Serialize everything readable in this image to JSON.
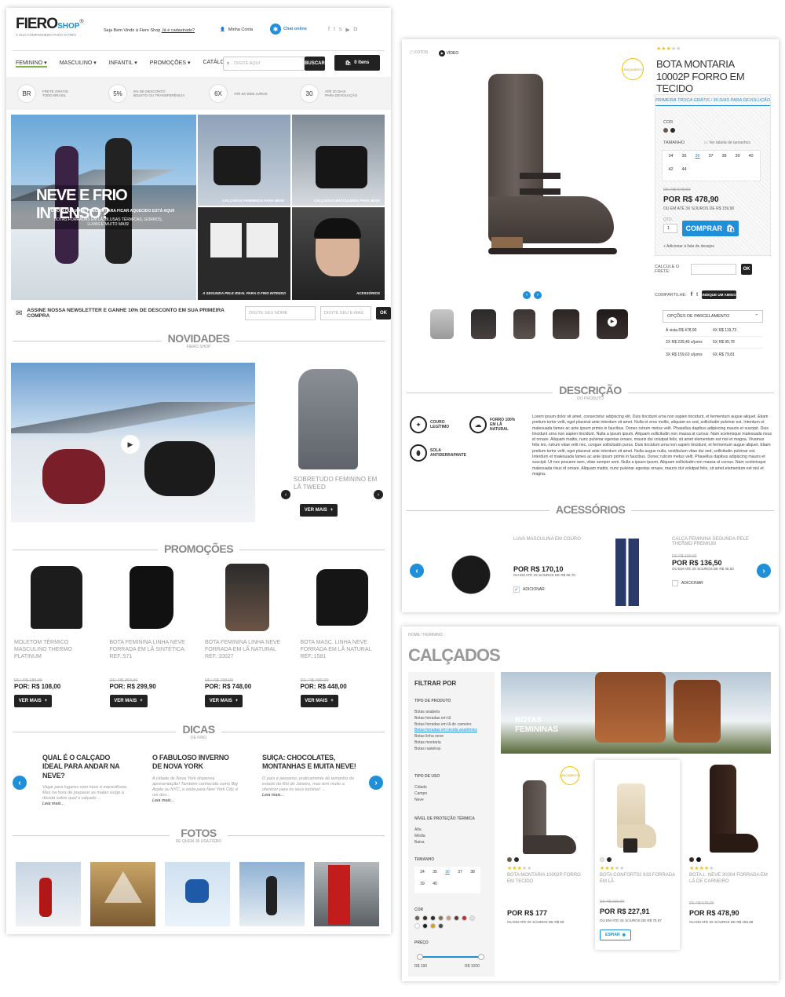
{
  "home": {
    "logo": {
      "main": "FIERO",
      "sub": "SHOP",
      "reg": "®",
      "tagline": "A SUA COMPANHEIRA PARA O FRIO"
    },
    "welcome": "Seja Bem Vindo à Fiero Shop",
    "register_link": "Já é cadastrado?",
    "my_account": "Minha Conta",
    "chat": "Chat online",
    "nav": [
      "FEMININO",
      "MASCULINO",
      "INFANTIL",
      "PROMOÇÕES",
      "CATÁLOGO"
    ],
    "search_placeholder": "DIGITE AQUI",
    "search_button": "BUSCAR",
    "cart": "0 Itens",
    "benefits": [
      {
        "badge": "BR",
        "text1": "FRETE GRÁTIS",
        "text2": "TODO BRASIL"
      },
      {
        "badge": "5%",
        "text1": "5% DE DESCONTO",
        "text2": "BOLETO OU TRANSFERÊNCIA"
      },
      {
        "badge": "6X",
        "text1": "ATÉ 6X SEM JUROS",
        "text2": ""
      },
      {
        "badge": "30",
        "text1": "ATÉ 30 DIAS",
        "text2": "PARA DEVOLUÇÃO"
      }
    ],
    "hero": {
      "title": "NEVE E FRIO INTENSO?",
      "subtitle": "TUDO O QUE VOCÊ PRECISA PARA FICAR AQUECIDO ESTÁ AQUI!",
      "text": "BOTAS FORRADAS EM LÃ, BLUSAS TÉRMICAS, GORROS, LUVAS E MUITO MAIS!",
      "tiles": [
        "CALÇADOS FEMININOS PARA NEVE",
        "CALÇADOS MASCULINOS PARA NEVE",
        "A SEGUNDA PELE IDEAL PARA O FRIO INTENSO",
        "ACESSÓRIOS"
      ]
    },
    "newsletter": {
      "text": "ASSINE NOSSA NEWSLETTER E GANHE 10% DE DESCONTO EM SUA PRIMEIRA COMPRA",
      "name_placeholder": "DIGITE SEU NOME",
      "email_placeholder": "DIGITE SEU E-MAIL",
      "ok": "OK"
    },
    "novidades": {
      "title": "NOVIDADES",
      "sub": "FIERO SHOP",
      "product": "SOBRETUDO FEMININO EM LÃ TWEED",
      "button": "VER MAIS"
    },
    "promocoes": {
      "title": "PROMOÇÕES",
      "items": [
        {
          "name": "MOLETOM TÉRMICO MASCULINO THERMO PLATINUM",
          "old": "DE: R$ 189,90",
          "price": "POR: R$ 108,00"
        },
        {
          "name": "BOTA FEMININA LINHA NEVE FORRADA EM LÃ SINTÉTICA REF.:571",
          "old": "DE: R$ 369,90",
          "price": "POR: R$ 299,90"
        },
        {
          "name": "BOTA FEMININA LINHA NEVE FORRADA EM LÃ NATURAL REF.:10027",
          "old": "DE: R$ 799,90",
          "price": "POR: R$ 748,00"
        },
        {
          "name": "BOTA MASC. LINHA NEVE FORRADA EM LÃ NATURAL REF.:1581",
          "old": "DE: R$ 489,90",
          "price": "POR: R$ 448,00"
        }
      ],
      "button": "VER MAIS"
    },
    "dicas": {
      "title": "DICAS",
      "sub": "DE FRIO",
      "items": [
        {
          "title": "QUAL É O CALÇADO IDEAL PARA ANDAR NA NEVE?",
          "text": "Viajar para lugares com neve é maravilhoso. Mas na hora de preparar as malas surge a dúvida sobre qual o calçado ...",
          "more": "Leia mais..."
        },
        {
          "title": "O FABULOSO INVERNO DE NOVA YORK",
          "text": "A cidade de Nova York dispensa apresentação! Também conhecida como Big Apple ou NYC, a visita para New York City, é um dos...",
          "more": "Leia mais..."
        },
        {
          "title": "SUIÇA: CHOCOLATES, MONTANHAS E MUITA NEVE!",
          "text": "O país é pequeno, praticamente do tamanho do estado do Rio de Janeiro, mas tem muito a oferecer para os seus turistas! ...",
          "more": "Leia mais..."
        }
      ]
    },
    "fotos": {
      "title": "FOTOS",
      "sub": "DE QUEM JÁ USA FIERO"
    }
  },
  "product": {
    "media_tabs": [
      "FOTOS",
      "VÍDEO"
    ],
    "badge": "LANÇAMENTO",
    "rating": 3,
    "title": "BOTA MONTARIA 10002P FORRO EM TECIDO",
    "shipping_note": "PRIMEIRA TROCA GRÁTIS / 30 DIAS PARA DEVOLUÇÃO",
    "color_label": "COR",
    "size_label": "TAMANHO",
    "size_table": "Ver tabela de tamanhos",
    "sizes": [
      "34",
      "35",
      "36",
      "37",
      "38",
      "39",
      "40",
      "42",
      "44"
    ],
    "selected_size": "36",
    "old_price": "DE R$ 578,90",
    "price": "POR R$ 478,90",
    "installments": "OU EM ATÉ 3X S/JUROS DE R$ 159,90",
    "qty_label": "QTD.",
    "qty_value": "1",
    "buy": "COMPRAR",
    "wishlist": "+ Adicionar à lista de desejos",
    "freight_label": "CALCULE O FRETE:",
    "ok": "OK",
    "share_label": "COMPARTILHE:",
    "recommend": "INDIQUE UM AMIGO",
    "installment_options": "OPÇÕES DE PARCELAMENTO",
    "installment_rows": [
      [
        "À vista R$ 478,90",
        "4X R$ 119,72"
      ],
      [
        "2X R$ 239,45 s/juros",
        "5X R$ 95,78"
      ],
      [
        "3X R$ 159,63 s/juros",
        "6X R$ 79,81"
      ]
    ],
    "descricao_title": "DESCRIÇÃO",
    "descricao_sub": "DO PRODUTO",
    "features": [
      "COURO LEGÍTIMO",
      "FORRO 100% EM LÃ NATURAL",
      "SOLA ANTIDERRAPANTE"
    ],
    "description": "Lorem ipsum dolor sit amet, consectetur adipiscing elit. Duis tincidunt urna non sapien tincidunt, et fermentum augue aliquet. Etiam pretium tortor velit, eget placerat ante interdum sit amet. Nulla et eros mollis, aliquam ex sed, sollicitudin pulvinar est. Interdum et malesuada fames ac ante ipsum primis in faucibus. Donec rutrum metus velit. Phasellus dapibus adipiscing mauris et suscipit. Duis tincidunt urna non sapien tincidunt. Nulla a ipsum ipsum. Aliquam sollicitudin non massa at cursus. Nam scelerisque malesuada risus id ornare. Aliquam mattis, nunc pulvinar egestas ornare, mauris dui volutpat felis, sit amet elementum est nisl et magna. Vivamus felis leo, rutrum vitae velit nec, congue sollicitudin purus. Duis tincidunt urna non sapien tincidunt, et fermentum augue aliquet. Etiam pretium tortor velit, eget placerat ante interdum sit amet. Nulla augue nulla, vestibulum vitae dui sed, sollicitudin pulvinar est. Interdum et malesuada fames ac ante ipsum primis in faucibus. Donec rutrum metus velit. Phasellus dapibus adipiscing mauris et suscipit. Ut nec posuere sem, vitae semper sem. Nulla a ipsum ipsum. Aliquam sollicitudin non massa at cursus. Nam scelerisque malesuada risus id ornare. Aliquam mattis, nunc pulvinar egestas ornare, mauris dui volutpat felis, sit amet elementum est nisl et magna.",
    "acessorios_title": "ACESSÓRIOS",
    "accessories": [
      {
        "name": "LUVA MASCULINA EM COURO",
        "price": "POR R$ 170,10",
        "inst": "OU EM ATÉ 3X S/JUROS DE R$ 56,70",
        "add": "ADICIONAR",
        "checked": true
      },
      {
        "name": "CALÇA FEMININA SEGUNDA PELE THERMO PREMIUM",
        "old": "DE R$ 190,90",
        "price": "POR R$ 136,50",
        "inst": "OU EM ATÉ 3X S/JUROS DE R$ 45,50",
        "add": "ADICIONAR",
        "checked": false
      }
    ]
  },
  "category": {
    "breadcrumb": "HOME / FEMININO",
    "title": "CALÇADOS",
    "filter_title": "FILTRAR POR",
    "tipo_produto": "TIPO DE PRODUTO",
    "tipo_items": [
      "Botas anabela",
      "Botas forradas em lã",
      "Botas forradas em lã de carneiro",
      "Botas forradas em tecido anatômico",
      "Botas linha neve",
      "Botas montaria",
      "Botas rasteiras"
    ],
    "tipo_uso": "TIPO DE USO",
    "uso_items": [
      "Cidade",
      "Campo",
      "Neve"
    ],
    "protecao": "NÍVEL DE PROTEÇÃO TÉRMICA",
    "protecao_items": [
      "Alta",
      "Média",
      "Baixa"
    ],
    "tamanho": "TAMANHO",
    "sizes": [
      "34",
      "35",
      "36",
      "37",
      "38",
      "39",
      "40"
    ],
    "cor": "COR",
    "colors": [
      "#6b5a4a",
      "#3b2a20",
      "#2a2a2a",
      "#8a6d4e",
      "#bfa27a",
      "#5a3b2e",
      "#c62828",
      "#e0e0e0",
      "#ffffff",
      "#1f1f1f",
      "#d4a017",
      "#4a4a4a"
    ],
    "preco": "PREÇO",
    "price_min": "R$ 190",
    "price_max": "R$ 1000",
    "banner": "BOTAS FEMININAS",
    "badge": "LANÇAMENTO",
    "products": [
      {
        "name": "BOTA MONTARIA 10002P FORRO EM TECIDO",
        "price": "POR R$ 177",
        "inst": "OU EM ATÉ 3X S/JUROS DE R$ 59",
        "rating": 3
      },
      {
        "name": "BOTA CONFORT02 933 FORRADA EM LÃ",
        "old": "DE R$ 239,90",
        "price": "POR R$ 227,91",
        "inst": "OU EM ATÉ 3X S/JUROS DE R$ 75,97",
        "rating": 3,
        "button": "ESPIAR"
      },
      {
        "name": "BOTA L. NEVE 30004 FORRADA EM LÃ DE CARNEIRO",
        "old": "DE R$ 575,90",
        "price": "POR R$ 478,90",
        "inst": "OU EM ATÉ 3X S/JUROS DE R$ 159,98",
        "rating": 4
      }
    ]
  }
}
